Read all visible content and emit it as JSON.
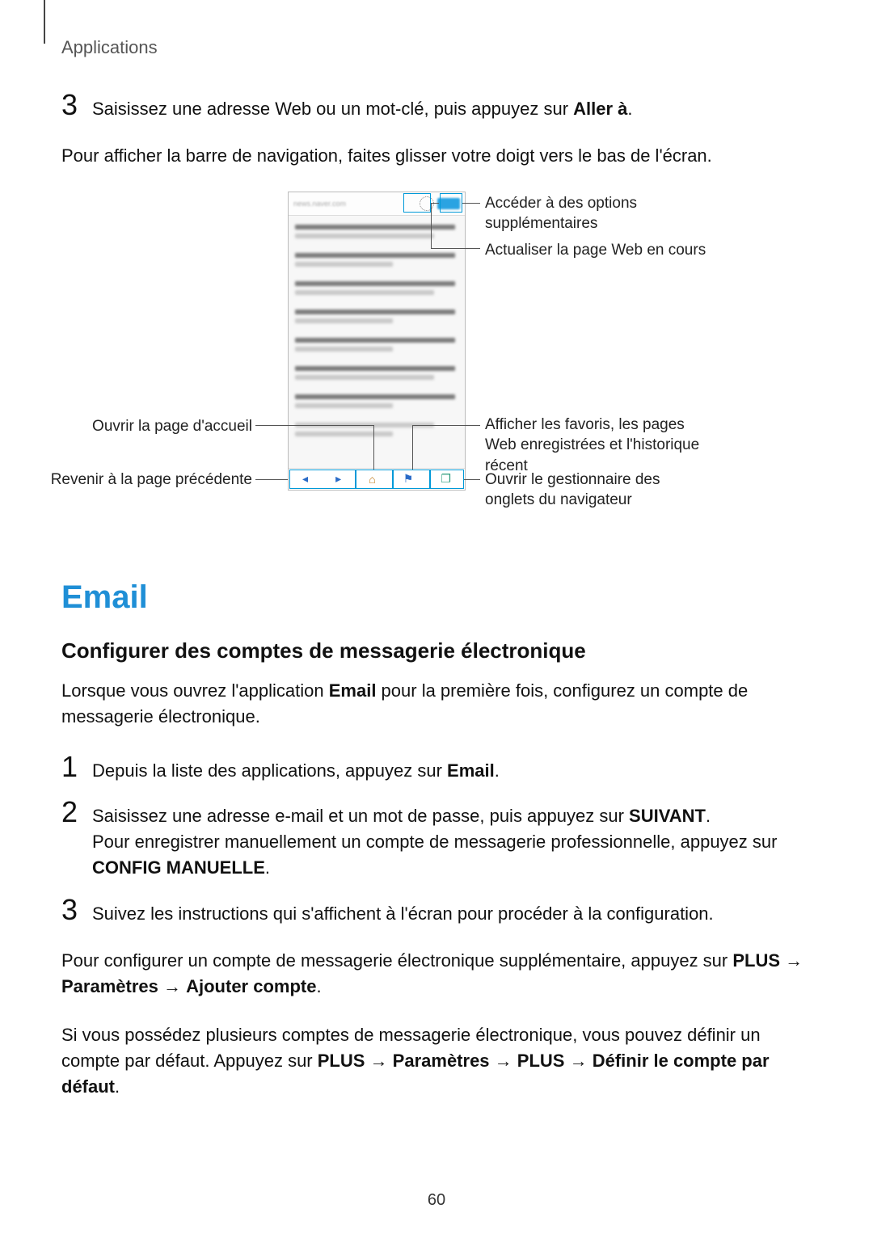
{
  "header": "Applications",
  "step3_top_pre": "Saisissez une adresse Web ou un mot-clé, puis appuyez sur ",
  "step3_top_bold": "Aller à",
  "step3_top_post": ".",
  "para_nav": "Pour afficher la barre de navigation, faites glisser votre doigt vers le bas de l'écran.",
  "callouts": {
    "more": "Accéder à des options supplémentaires",
    "refresh": "Actualiser la page Web en cours",
    "home": "Ouvrir la page d'accueil",
    "back": "Revenir à la page précédente",
    "bookmarks": "Afficher les favoris, les pages Web enregistrées et l'historique récent",
    "tabs": "Ouvrir le gestionnaire des onglets du navigateur"
  },
  "section_title": "Email",
  "subsection_title": "Configurer des comptes de messagerie électronique",
  "intro_pre": "Lorsque vous ouvrez l'application ",
  "intro_bold": "Email",
  "intro_post": " pour la première fois, configurez un compte de messagerie électronique.",
  "step1_pre": "Depuis la liste des applications, appuyez sur ",
  "step1_bold": "Email",
  "step1_post": ".",
  "step2_line1_pre": "Saisissez une adresse e-mail et un mot de passe, puis appuyez sur ",
  "step2_line1_bold": "SUIVANT",
  "step2_line1_post": ".",
  "step2_line2_pre": "Pour enregistrer manuellement un compte de messagerie professionnelle, appuyez sur ",
  "step2_line2_bold": "CONFIG MANUELLE",
  "step2_line2_post": ".",
  "step3_text": "Suivez les instructions qui s'affichent à l'écran pour procéder à la configuration.",
  "para_plus_pre": "Pour configurer un compte de messagerie électronique supplémentaire, appuyez sur ",
  "para_plus_bold1": "PLUS",
  "arrow": " → ",
  "para_plus_bold2": "Paramètres",
  "para_plus_bold3": "Ajouter compte",
  "para_plus_post": ".",
  "para_default_pre": "Si vous possédez plusieurs comptes de messagerie électronique, vous pouvez définir un compte par défaut. Appuyez sur ",
  "para_default_b1": "PLUS",
  "para_default_b2": "Paramètres",
  "para_default_b3": "PLUS",
  "para_default_b4": "Définir le compte par défaut",
  "para_default_post": ".",
  "page_number": "60"
}
